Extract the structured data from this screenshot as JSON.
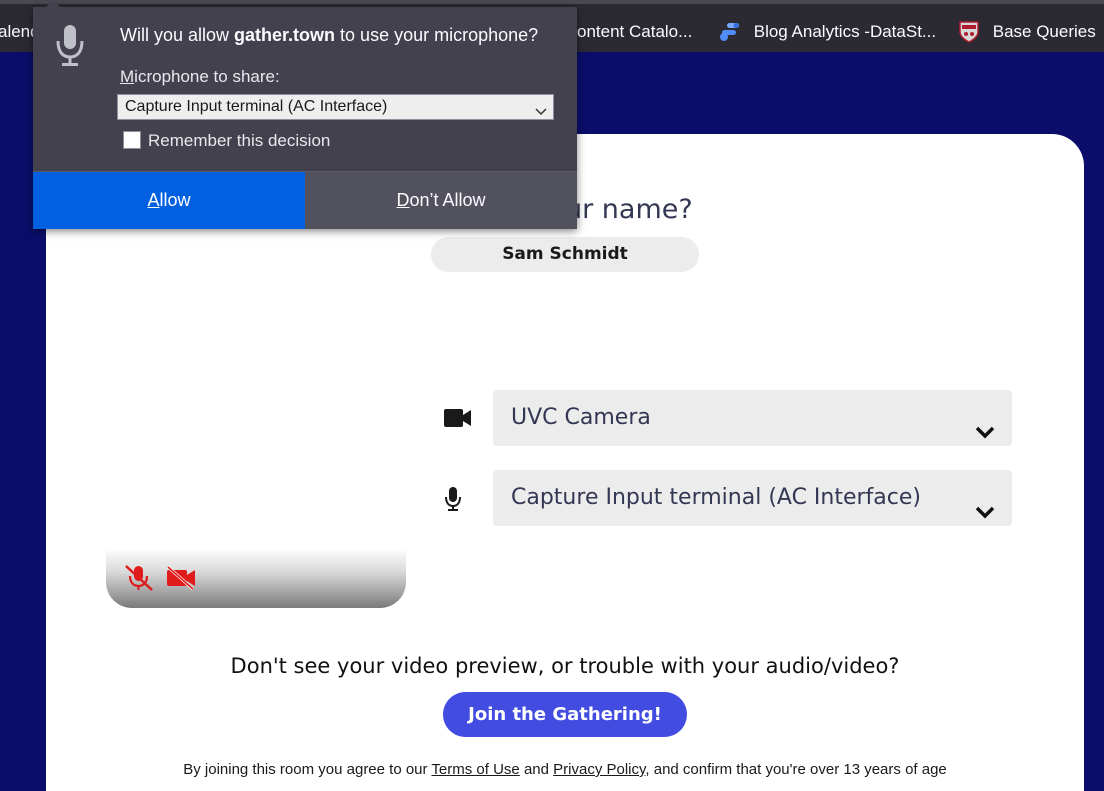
{
  "bookmarks": {
    "items": [
      {
        "label": "alend",
        "icon": "calendar-icon"
      },
      {
        "label": "ontent Catalo...",
        "icon": "catalog-icon"
      },
      {
        "label": "Blog Analytics -DataSt...",
        "icon": "data-studio-icon"
      },
      {
        "label": "Base Queries",
        "icon": "shield-crest-icon"
      }
    ]
  },
  "permission_dialog": {
    "question_prefix": "Will you allow ",
    "site": "gather.town",
    "question_suffix": " to use your microphone?",
    "share_label_first": "M",
    "share_label_rest": "icrophone to share:",
    "selected_device": "Capture Input terminal (AC Interface)",
    "remember_label": "Remember this decision",
    "remember_checked": false,
    "allow_first": "A",
    "allow_rest": "llow",
    "deny_first": "D",
    "deny_rest": "on’t Allow",
    "accent_color": "#0060df"
  },
  "setup": {
    "title": "ur name?",
    "name_value": "Sam Schmidt",
    "camera_select": "UVC Camera",
    "mic_select": "Capture Input terminal (AC Interface)",
    "preview_icons": [
      "mic-muted-icon",
      "camera-off-icon"
    ],
    "trouble_text": "Don't see your video preview, or trouble with your audio/video?",
    "join_button": "Join the Gathering!",
    "legal_prefix": "By joining this room you agree to our ",
    "terms_link": "Terms of Use",
    "legal_and": " and ",
    "privacy_link": "Privacy Policy",
    "legal_suffix": ", and confirm that you're over 13 years of age",
    "brand_color": "#434ce0",
    "background_color": "#0a0e6a"
  }
}
